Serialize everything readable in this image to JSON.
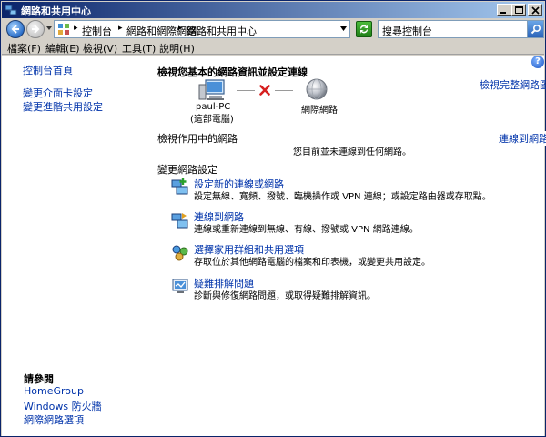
{
  "window": {
    "title": "網路和共用中心"
  },
  "address_bar": {
    "breadcrumbs": [
      "控制台",
      "網路和網際網路",
      "網路和共用中心"
    ],
    "search_placeholder": "搜尋控制台"
  },
  "menu": {
    "items": [
      "檔案(F)",
      "編輯(E)",
      "檢視(V)",
      "工具(T)",
      "說明(H)"
    ]
  },
  "sidebar": {
    "home": "控制台首頁",
    "links": [
      "變更介面卡設定",
      "變更進階共用設定"
    ],
    "see_also_title": "請參閱",
    "see_also": [
      "HomeGroup",
      "Windows 防火牆",
      "網際網路選項"
    ]
  },
  "main": {
    "heading": "檢視您基本的網路資訊並設定連線",
    "view_full_map": "檢視完整網路圖",
    "computer_name": "paul-PC",
    "computer_sub": "(這部電腦)",
    "internet_label": "網際網路",
    "active_networks_title": "檢視作用中的網路",
    "connect_link": "連線到網路",
    "not_connected": "您目前並未連線到任何網路。",
    "change_settings_title": "變更網路設定",
    "tasks": [
      {
        "title": "設定新的連線或網路",
        "desc": "設定無線、寬頻、撥號、臨機操作或 VPN 連線；或設定路由器或存取點。"
      },
      {
        "title": "連線到網路",
        "desc": "連線或重新連線到無線、有線、撥號或 VPN 網路連線。"
      },
      {
        "title": "選擇家用群組和共用選項",
        "desc": "存取位於其他網路電腦的檔案和印表機，或變更共用設定。"
      },
      {
        "title": "疑難排解問題",
        "desc": "診斷與修復網路問題，或取得疑難排解資訊。"
      }
    ]
  },
  "colors": {
    "link": "#0033aa",
    "title_bar_start": "#0a246a",
    "title_bar_end": "#a6caf0",
    "error_x": "#d62020"
  }
}
